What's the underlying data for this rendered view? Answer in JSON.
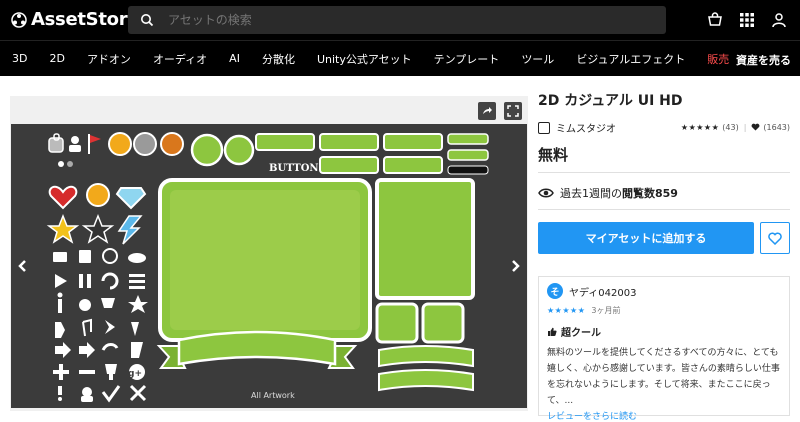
{
  "header": {
    "logo_text": "AssetStore",
    "search_placeholder": "アセットの検索",
    "icons": [
      "cart-icon",
      "grid-icon",
      "user-icon"
    ]
  },
  "categories": [
    "3D",
    "2D",
    "アドオン",
    "オーディオ",
    "AI",
    "分散化",
    "Unity公式アセット",
    "テンプレート",
    "ツール",
    "ビジュアルエフェクト",
    "販売"
  ],
  "sell_label": "資産を売る",
  "product": {
    "title": "2D カジュアル UI HD",
    "publisher": "ミムスタジオ",
    "rating_count": "(43)",
    "favorites_count": "(1643)",
    "price": "無料",
    "views_prefix": "過去1週間の",
    "views_label": "閲覧数",
    "views_count": "859",
    "add_button": "マイアセットに追加する"
  },
  "gallery": {
    "caption": "All Artwork",
    "button_text": "BUTTON"
  },
  "review": {
    "avatar_letter": "そ",
    "reviewer": "ヤディ042003",
    "time_ago": "3ヶ月前",
    "title": "超クール",
    "body": "無料のツールを提供してくださるすべての方々に、とても嬉しく、心から感謝しています。皆さんの素晴らしい仕事を忘れないようにします。そして将来、またここに戻って、...",
    "read_more": "レビューをさらに読む"
  },
  "colors": {
    "accent": "#2196f3",
    "sale": "#ff4d4d",
    "ui_green": "#8dc63f"
  }
}
